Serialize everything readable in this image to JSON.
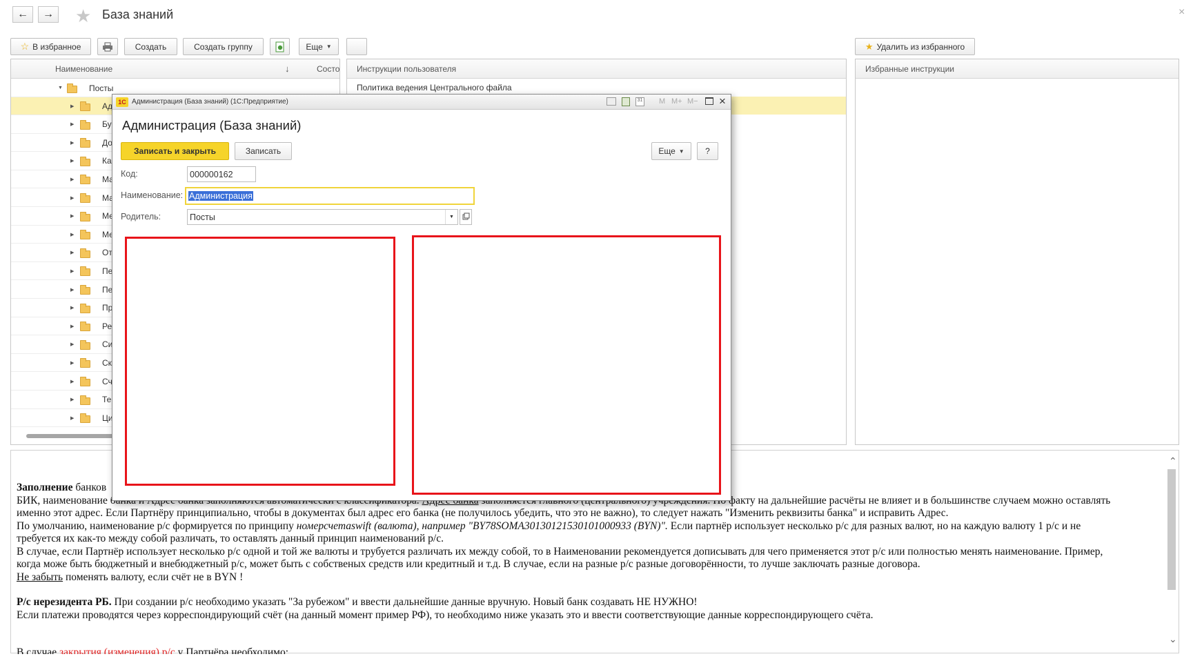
{
  "window": {
    "title": "База знаний",
    "close_glyph": "×"
  },
  "toolbar_left": {
    "favorites_label": "В избранное",
    "create_label": "Создать",
    "create_group_label": "Создать группу",
    "more_label": "Еще"
  },
  "toolbar_right": {
    "remove_favorite_label": "Удалить из избранного"
  },
  "tree": {
    "col_name": "Наименование",
    "col_state": "Состо",
    "root_label": "Посты",
    "items": [
      "Ад",
      "Бу",
      "До",
      "Ка",
      "Ма",
      "Ма",
      "Ме",
      "Ме",
      "От",
      "Пе",
      "Пе",
      "Пр",
      "Ре",
      "Си",
      "Ск",
      "Сч",
      "Те",
      "Ци"
    ]
  },
  "instructions": {
    "header": "Инструкции пользователя",
    "items": [
      "Политика ведения Центрального файла"
    ]
  },
  "favorites": {
    "header": "Избранные инструкции"
  },
  "dialog": {
    "window_title": "Администрация (База знаний)  (1С:Предприятие)",
    "logo_text": "1С",
    "tool_m": "M",
    "tool_m_plus": "M+",
    "tool_m_minus": "M−",
    "heading": "Администрация (База знаний)",
    "save_close_label": "Записать и закрыть",
    "save_label": "Записать",
    "more_label": "Еще",
    "help_label": "?",
    "code_label": "Код:",
    "code_value": "000000162",
    "name_label": "Наименование:",
    "name_value": "Администрация",
    "parent_label": "Родитель:",
    "parent_value": "Посты"
  },
  "document": {
    "p1_bold": "Заполнение",
    "p1_rest": " банков",
    "p2_a": "БИК, наименование банка и Адрес банка заполняются автоматически с классификатора. ",
    "p2_link": "Адрес банка",
    "p2_b": " заполняется главного (центрального) учреждения. По факту на дальнейшие расчёты не влияет и в большинстве случаем можно оставлять",
    "p3": "именно этот адрес. Если Партнёру принципиально, чтобы в документах был адрес его банка (не получилось убедить, что это не важно), то следует нажать \"Изменить реквизиты банка\" и исправить Адрес.",
    "p4_a": "По умолчанию, наименование р/с формируется по принципу ",
    "p4_italic": "номерсчетаswift (валюта), например \"BY78SOMA30130121530101000933 (BYN)\".",
    "p4_b": " Если партнёр использует несколько р/с для разных валют, но на каждую валюту 1 р/с и не",
    "p5": "требуется их как-то между собой различать, то оставлять данный принцип наименований р/с.",
    "p6": "В случае, если Партнёр использует несколько р/с одной и той же валюты и трубуется различать их между собой, то в Наименовании рекомендуется дописывать для чего применяется этот р/с или полностью менять наименование. Пример,",
    "p7": "когда може быть бюджетный и внебюджетный р/с, может быть с собственых средств или кредитный и т.д. В случае, если на разные р/с разные договорённости, то лучше заключать разные договора.",
    "p8_link": "Не забыть",
    "p8_rest": " поменять валюту, если счёт не в BYN !",
    "p9_bold": "Р/с нерезидента РБ.",
    "p9_rest": " При создании р/с необходимо указать \"За рубежом\" и ввести дальнейшие данные вручную. Новый банк создавать НЕ НУЖНО!",
    "p10": "Если платежи проводятся через корреспондирующий счёт (на данный момент пример РФ), то необходимо ниже указать это и ввести соответствующие данные корреспондирующего счёта.",
    "p11_a": "В случае ",
    "p11_red": "закрытия (изменения) р/с",
    "p11_b": " у Партнёра необходимо:"
  },
  "colors": {
    "accent_yellow": "#f6d42a",
    "selection_row": "#fbf1b3",
    "red_box": "#e8141a",
    "text_selection": "#3a6fd8"
  }
}
